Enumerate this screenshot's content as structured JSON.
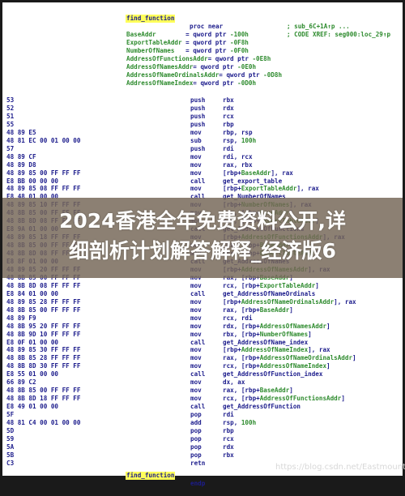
{
  "header": {
    "label": "find_function",
    "proc": "proc near",
    "comments": [
      "; CODE XREF: seg000:loc_29↑p",
      "; sub_6C+1A↑p ..."
    ]
  },
  "vars": [
    {
      "name": "BaseAddr",
      "sep": "        = ",
      "type": "qword ptr ",
      "off": "-100h"
    },
    {
      "name": "ExportTableAddr",
      "sep": " = ",
      "type": "qword ptr ",
      "off": "-0F8h"
    },
    {
      "name": "NumberOfNames",
      "sep": "   = ",
      "type": "qword ptr ",
      "off": "-0F0h"
    },
    {
      "name": "AddressOfFunctionsAddr",
      "sep": "= ",
      "type": "qword ptr ",
      "off": "-0E8h"
    },
    {
      "name": "AddressOfNamesAddr",
      "sep": "= ",
      "type": "qword ptr ",
      "off": "-0E0h"
    },
    {
      "name": "AddressOfNameOrdinalsAddr",
      "sep": "= ",
      "type": "qword ptr ",
      "off": "-0D8h"
    },
    {
      "name": "AddressOfNameIndex",
      "sep": "= ",
      "type": "qword ptr ",
      "off": "-0D0h"
    }
  ],
  "lines": [
    {
      "hex": "53",
      "mn": "push",
      "ops": [
        {
          "t": "rbx"
        }
      ]
    },
    {
      "hex": "52",
      "mn": "push",
      "ops": [
        {
          "t": "rdx"
        }
      ]
    },
    {
      "hex": "51",
      "mn": "push",
      "ops": [
        {
          "t": "rcx"
        }
      ]
    },
    {
      "hex": "55",
      "mn": "push",
      "ops": [
        {
          "t": "rbp"
        }
      ]
    },
    {
      "hex": "48 89 E5",
      "mn": "mov",
      "ops": [
        {
          "t": "rbp, rsp"
        }
      ]
    },
    {
      "hex": "48 81 EC 00 01 00 00",
      "mn": "sub",
      "ops": [
        {
          "t": "rsp, "
        },
        {
          "t": "100h",
          "g": true
        }
      ]
    },
    {
      "hex": "57",
      "mn": "push",
      "ops": [
        {
          "t": "rdi"
        }
      ]
    },
    {
      "hex": "48 89 CF",
      "mn": "mov",
      "ops": [
        {
          "t": "rdi, rcx"
        }
      ]
    },
    {
      "hex": "48 89 D8",
      "mn": "mov",
      "ops": [
        {
          "t": "rax, rbx"
        }
      ]
    },
    {
      "hex": "48 89 85 00 FF FF FF",
      "mn": "mov",
      "ops": [
        {
          "t": "[rbp+"
        },
        {
          "t": "BaseAddr",
          "g": true
        },
        {
          "t": "], rax"
        }
      ]
    },
    {
      "hex": "E8 BB 00 00 00",
      "mn": "call",
      "ops": [
        {
          "t": "get_export_table"
        }
      ]
    },
    {
      "hex": "48 89 85 08 FF FF FF",
      "mn": "mov",
      "ops": [
        {
          "t": "[rbp+"
        },
        {
          "t": "ExportTableAddr",
          "g": true
        },
        {
          "t": "], rax"
        }
      ]
    },
    {
      "hex": "E8 48 01 00 00",
      "mn": "call",
      "ops": [
        {
          "t": "get_NumberOfNames"
        }
      ]
    },
    {
      "hex": "48 89 85 10 FF FF FF",
      "mn": "mov",
      "ops": [
        {
          "t": "[rbp+"
        },
        {
          "t": "NumberOfNames",
          "g": true
        },
        {
          "t": "], rax"
        }
      ]
    },
    {
      "hex": "48 8B 85 00 FF FF FF",
      "mn": "mov",
      "ops": [
        {
          "t": "rax, [rbp+"
        },
        {
          "t": "BaseAddr",
          "g": true
        },
        {
          "t": "]"
        }
      ]
    },
    {
      "hex": "48 8B 8D 08 FF FF FF",
      "mn": "mov",
      "ops": [
        {
          "t": "rcx, [rbp+"
        },
        {
          "t": "ExportTableAddr",
          "g": true
        },
        {
          "t": "]"
        }
      ]
    },
    {
      "hex": "E8 9A 01 00 00",
      "mn": "call",
      "ops": [
        {
          "t": "get_AddressOfFunctions"
        }
      ]
    },
    {
      "hex": "48 89 85 18 FF FF FF",
      "mn": "mov",
      "ops": [
        {
          "t": "[rbp+"
        },
        {
          "t": "AddressOfFunctionsAddr",
          "g": true
        },
        {
          "t": "], rax"
        }
      ]
    },
    {
      "hex": "48 8B 85 00 FF FF FF",
      "mn": "mov",
      "ops": [
        {
          "t": "rax, [rbp+"
        },
        {
          "t": "BaseAddr",
          "g": true
        },
        {
          "t": "]"
        }
      ]
    },
    {
      "hex": "48 8B 8D 08 FF FF FF",
      "mn": "mov",
      "ops": [
        {
          "t": "rcx, [rbp+"
        },
        {
          "t": "ExportTableAddr",
          "g": true
        },
        {
          "t": "]"
        }
      ]
    },
    {
      "hex": "E8 8F 01 00 00",
      "mn": "call",
      "ops": [
        {
          "t": "get_AddressOfNames"
        }
      ]
    },
    {
      "hex": "48 89 85 20 FF FF FF",
      "mn": "mov",
      "ops": [
        {
          "t": "[rbp+"
        },
        {
          "t": "AddressOfNamesAddr",
          "g": true
        },
        {
          "t": "], rax"
        }
      ]
    },
    {
      "hex": "48 8B 85 00 FF FF FF",
      "mn": "mov",
      "ops": [
        {
          "t": "rax, [rbp+"
        },
        {
          "t": "BaseAddr",
          "g": true
        },
        {
          "t": "]"
        }
      ]
    },
    {
      "hex": "48 8B 8D 08 FF FF FF",
      "mn": "mov",
      "ops": [
        {
          "t": "rcx, [rbp+"
        },
        {
          "t": "ExportTableAddr",
          "g": true
        },
        {
          "t": "]"
        }
      ]
    },
    {
      "hex": "E8 84 01 00 00",
      "mn": "call",
      "ops": [
        {
          "t": "get_AddressOfNameOrdinals"
        }
      ]
    },
    {
      "hex": "48 89 85 28 FF FF FF",
      "mn": "mov",
      "ops": [
        {
          "t": "[rbp+"
        },
        {
          "t": "AddressOfNameOrdinalsAddr",
          "g": true
        },
        {
          "t": "], rax"
        }
      ]
    },
    {
      "hex": "48 8B 85 00 FF FF FF",
      "mn": "mov",
      "ops": [
        {
          "t": "rax, [rbp+"
        },
        {
          "t": "BaseAddr",
          "g": true
        },
        {
          "t": "]"
        }
      ]
    },
    {
      "hex": "48 89 F9",
      "mn": "mov",
      "ops": [
        {
          "t": "rcx, rdi"
        }
      ]
    },
    {
      "hex": "48 8B 95 20 FF FF FF",
      "mn": "mov",
      "ops": [
        {
          "t": "rdx, [rbp+"
        },
        {
          "t": "AddressOfNamesAddr",
          "g": true
        },
        {
          "t": "]"
        }
      ]
    },
    {
      "hex": "48 8B 9D 10 FF FF FF",
      "mn": "mov",
      "ops": [
        {
          "t": "rbx, [rbp+"
        },
        {
          "t": "NumberOfNames",
          "g": true
        },
        {
          "t": "]"
        }
      ]
    },
    {
      "hex": "E8 0F 01 00 00",
      "mn": "call",
      "ops": [
        {
          "t": "get_AddressOfName_index"
        }
      ]
    },
    {
      "hex": "48 89 85 30 FF FF FF",
      "mn": "mov",
      "ops": [
        {
          "t": "[rbp+"
        },
        {
          "t": "AddressOfNameIndex",
          "g": true
        },
        {
          "t": "], rax"
        }
      ]
    },
    {
      "hex": "48 8B 85 28 FF FF FF",
      "mn": "mov",
      "ops": [
        {
          "t": "rax, [rbp+"
        },
        {
          "t": "AddressOfNameOrdinalsAddr",
          "g": true
        },
        {
          "t": "]"
        }
      ]
    },
    {
      "hex": "48 8B 8D 30 FF FF FF",
      "mn": "mov",
      "ops": [
        {
          "t": "rcx, [rbp+"
        },
        {
          "t": "AddressOfNameIndex",
          "g": true
        },
        {
          "t": "]"
        }
      ]
    },
    {
      "hex": "E8 55 01 00 00",
      "mn": "call",
      "ops": [
        {
          "t": "get_AddressOfFunction_index"
        }
      ]
    },
    {
      "hex": "66 89 C2",
      "mn": "mov",
      "ops": [
        {
          "t": "dx, ax"
        }
      ]
    },
    {
      "hex": "48 8B 85 00 FF FF FF",
      "mn": "mov",
      "ops": [
        {
          "t": "rax, [rbp+"
        },
        {
          "t": "BaseAddr",
          "g": true
        },
        {
          "t": "]"
        }
      ]
    },
    {
      "hex": "48 8B 8D 18 FF FF FF",
      "mn": "mov",
      "ops": [
        {
          "t": "rcx, [rbp+"
        },
        {
          "t": "AddressOfFunctionsAddr",
          "g": true
        },
        {
          "t": "]"
        }
      ]
    },
    {
      "hex": "E8 49 01 00 00",
      "mn": "call",
      "ops": [
        {
          "t": "get_AddressOfFunction"
        }
      ]
    },
    {
      "hex": "5F",
      "mn": "pop",
      "ops": [
        {
          "t": "rdi"
        }
      ]
    },
    {
      "hex": "48 81 C4 00 01 00 00",
      "mn": "add",
      "ops": [
        {
          "t": "rsp, "
        },
        {
          "t": "100h",
          "g": true
        }
      ]
    },
    {
      "hex": "5D",
      "mn": "pop",
      "ops": [
        {
          "t": "rbp"
        }
      ]
    },
    {
      "hex": "59",
      "mn": "pop",
      "ops": [
        {
          "t": "rcx"
        }
      ]
    },
    {
      "hex": "5A",
      "mn": "pop",
      "ops": [
        {
          "t": "rdx"
        }
      ]
    },
    {
      "hex": "5B",
      "mn": "pop",
      "ops": [
        {
          "t": "rbx"
        }
      ]
    },
    {
      "hex": "C3",
      "mn": "retn",
      "ops": []
    }
  ],
  "footer": {
    "label": "find_function",
    "mn": "endp"
  },
  "banner": {
    "line1": "2024香港全年免费资料公开,详",
    "line2": "细剖析计划解答解释_经济版6"
  },
  "watermark": "https://blog.csdn.net/Eastmount",
  "colors": {
    "mnemonic": "#1c1c8c",
    "symbol": "#2e8b2e",
    "label_bg": "#ffff5a"
  }
}
